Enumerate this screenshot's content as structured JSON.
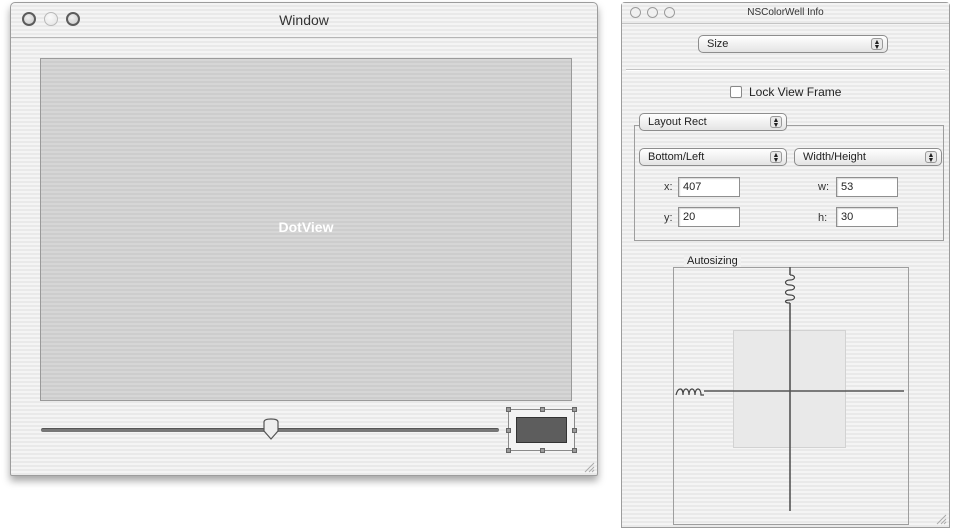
{
  "window": {
    "title": "Window",
    "dotview_label": "DotView"
  },
  "info_panel": {
    "title": "NSColorWell Info",
    "view_popup": "Size",
    "lock_view_frame": {
      "label": "Lock View Frame",
      "checked": false
    },
    "layout_popup": "Layout Rect",
    "origin_popup": "Bottom/Left",
    "size_popup": "Width/Height",
    "fields": {
      "x": {
        "label": "x:",
        "value": "407"
      },
      "y": {
        "label": "y:",
        "value": "20"
      },
      "w": {
        "label": "w:",
        "value": "53"
      },
      "h": {
        "label": "h:",
        "value": "30"
      }
    },
    "autosizing_label": "Autosizing"
  },
  "colors": {
    "color_well": "#5d5d5d",
    "dotview_bg": "#d3d3d3"
  }
}
